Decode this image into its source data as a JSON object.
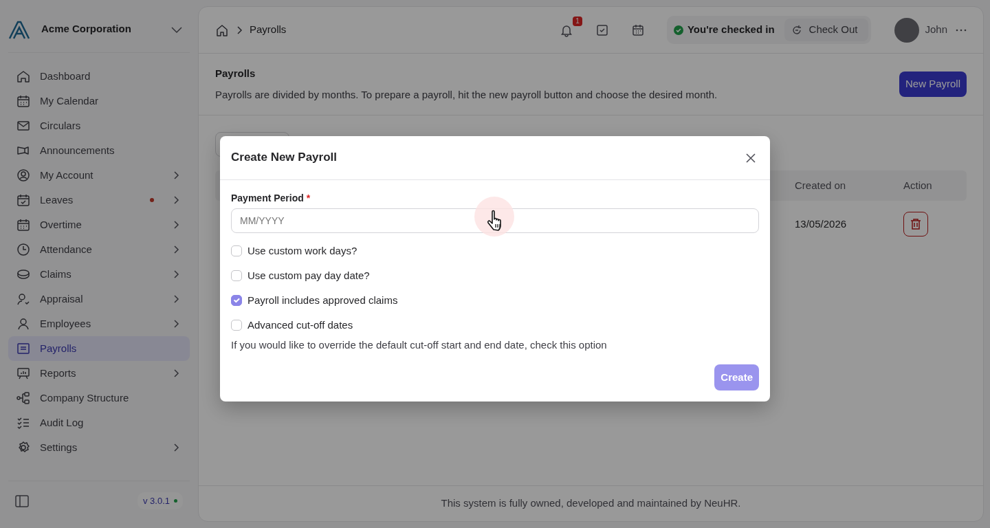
{
  "sidebar": {
    "company": "Acme Corporation",
    "items": [
      {
        "label": "Dashboard",
        "has_submenu": false,
        "notification": false,
        "selected": false
      },
      {
        "label": "My Calendar",
        "has_submenu": false,
        "notification": false,
        "selected": false
      },
      {
        "label": "Circulars",
        "has_submenu": false,
        "notification": false,
        "selected": false
      },
      {
        "label": "Announcements",
        "has_submenu": false,
        "notification": false,
        "selected": false
      },
      {
        "label": "My Account",
        "has_submenu": true,
        "notification": false,
        "selected": false
      },
      {
        "label": "Leaves",
        "has_submenu": true,
        "notification": true,
        "selected": false
      },
      {
        "label": "Overtime",
        "has_submenu": true,
        "notification": false,
        "selected": false
      },
      {
        "label": "Attendance",
        "has_submenu": true,
        "notification": false,
        "selected": false
      },
      {
        "label": "Claims",
        "has_submenu": true,
        "notification": false,
        "selected": false
      },
      {
        "label": "Appraisal",
        "has_submenu": true,
        "notification": false,
        "selected": false
      },
      {
        "label": "Employees",
        "has_submenu": true,
        "notification": false,
        "selected": false
      },
      {
        "label": "Payrolls",
        "has_submenu": false,
        "notification": false,
        "selected": true
      },
      {
        "label": "Reports",
        "has_submenu": true,
        "notification": false,
        "selected": false
      },
      {
        "label": "Company Structure",
        "has_submenu": false,
        "notification": false,
        "selected": false
      },
      {
        "label": "Audit Log",
        "has_submenu": false,
        "notification": false,
        "selected": false
      },
      {
        "label": "Settings",
        "has_submenu": true,
        "notification": false,
        "selected": false
      }
    ],
    "version": "v 3.0.1"
  },
  "topbar": {
    "breadcrumb": "Payrolls",
    "notification_count": "1",
    "check_status": "You're checked in",
    "check_button": "Check Out",
    "user": "John"
  },
  "page_header": {
    "title": "Payrolls",
    "description": "Payrolls are divided by months. To prepare a payroll, hit the new payroll button and choose the desired month.",
    "button": "New Payroll"
  },
  "table": {
    "columns": [
      "Created on",
      "Action"
    ],
    "rows": [
      {
        "created_on": "13/05/2026"
      }
    ]
  },
  "modal": {
    "title": "Create New Payroll",
    "field": {
      "label": "Payment Period",
      "required_mark": "*",
      "placeholder": "MM/YYYY"
    },
    "options": [
      {
        "label": "Use custom work days?",
        "checked": false
      },
      {
        "label": "Use custom pay day date?",
        "checked": false
      },
      {
        "label": "Payroll includes approved claims",
        "checked": true
      },
      {
        "label": "Advanced cut-off dates",
        "checked": false
      }
    ],
    "help": "If you would like to override the default cut-off start and end date, check this option",
    "button": "Create",
    "button_disabled": true
  },
  "footer": "This system is fully owned, developed and maintained by NeuHR."
}
